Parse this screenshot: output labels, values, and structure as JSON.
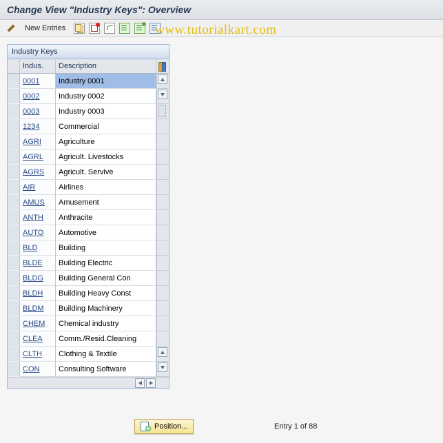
{
  "title": "Change View \"Industry Keys\": Overview",
  "toolbar": {
    "new_entries_label": "New Entries",
    "icons": [
      "pencil",
      "copy",
      "delete",
      "undo",
      "select-all",
      "select-block",
      "deselect-all"
    ]
  },
  "watermark": "www.tutorialkart.com",
  "panel": {
    "header": "Industry Keys",
    "columns": {
      "indus": "Indus.",
      "description": "Description"
    }
  },
  "rows": [
    {
      "code": "0001",
      "desc": "Industry 0001",
      "highlight": true
    },
    {
      "code": "0002",
      "desc": "Industry 0002"
    },
    {
      "code": "0003",
      "desc": "Industry 0003"
    },
    {
      "code": "1234",
      "desc": "Commercial"
    },
    {
      "code": "AGRI",
      "desc": "Agriculture"
    },
    {
      "code": "AGRL",
      "desc": "Agricult. Livestocks"
    },
    {
      "code": "AGRS",
      "desc": "Agricult. Servive"
    },
    {
      "code": "AIR",
      "desc": "Airlines"
    },
    {
      "code": "AMUS",
      "desc": "Amusement"
    },
    {
      "code": "ANTH",
      "desc": "Anthracite"
    },
    {
      "code": "AUTO",
      "desc": "Automotive"
    },
    {
      "code": "BLD",
      "desc": "Building"
    },
    {
      "code": "BLDE",
      "desc": "Building Electric"
    },
    {
      "code": "BLDG",
      "desc": "Building General Con"
    },
    {
      "code": "BLDH",
      "desc": "Building Heavy Const"
    },
    {
      "code": "BLDM",
      "desc": "Building Machinery"
    },
    {
      "code": "CHEM",
      "desc": "Chemical industry"
    },
    {
      "code": "CLEA",
      "desc": "Comm./Resid.Cleaning"
    },
    {
      "code": "CLTH",
      "desc": "Clothing & Textile"
    },
    {
      "code": "CON",
      "desc": "Consulting Software"
    }
  ],
  "footer": {
    "position_label": "Position...",
    "entry_text": "Entry 1 of 88"
  }
}
